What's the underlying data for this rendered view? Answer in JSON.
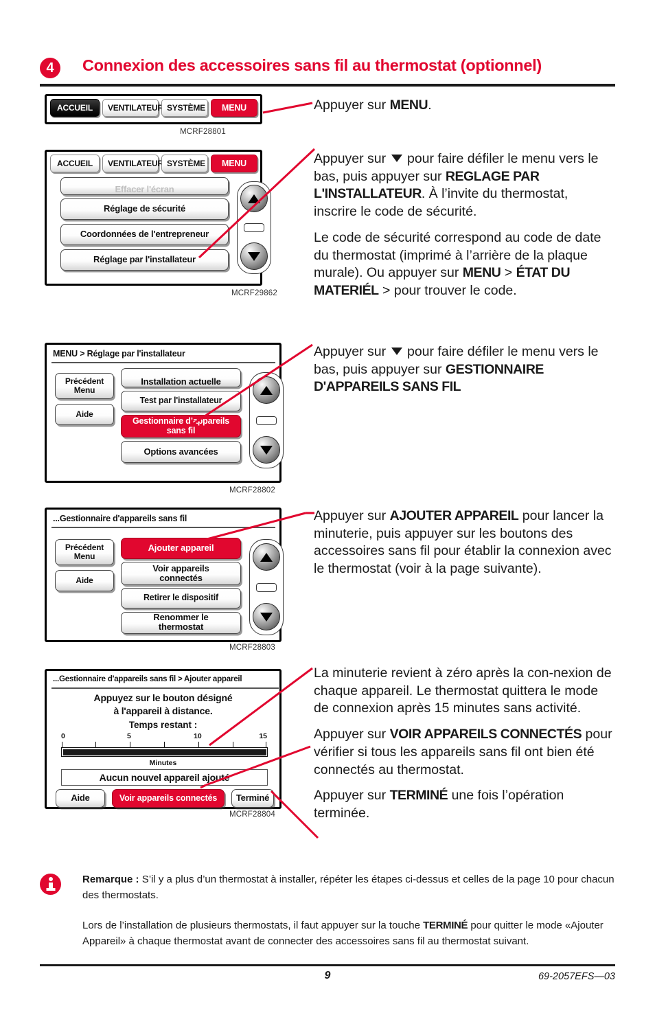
{
  "header": {
    "step_number": "4",
    "title": "Connexion des accessoires sans fil au thermostat (optionnel)"
  },
  "screens": [
    {
      "id": "screen-1",
      "caption": "MCRF28801",
      "tabs": [
        {
          "label": "ACCUEIL",
          "style": "dark"
        },
        {
          "label": "VENTILATEUR",
          "style": "light"
        },
        {
          "label": "SYSTÈME",
          "style": "light"
        },
        {
          "label": "MENU",
          "style": "red"
        }
      ]
    },
    {
      "id": "screen-2",
      "caption": "MCRF29862",
      "tabs": [
        {
          "label": "ACCUEIL",
          "style": "light"
        },
        {
          "label": "VENTILATEUR",
          "style": "light"
        },
        {
          "label": "SYSTÈME",
          "style": "light"
        },
        {
          "label": "MENU",
          "style": "red"
        }
      ],
      "items": [
        {
          "label": "Effacer l'écran",
          "style": "light",
          "clipped": true
        },
        {
          "label": "Réglage de sécurité",
          "style": "light"
        },
        {
          "label": "Coordonnées de l'entrepreneur",
          "style": "light"
        },
        {
          "label": "Réglage par l'installateur",
          "style": "light"
        }
      ]
    },
    {
      "id": "screen-3",
      "caption": "MCRF28802",
      "breadcrumb": "MENU > Réglage par l'installateur",
      "side_buttons": [
        {
          "label": "Précédent\nMenu"
        },
        {
          "label": "Aide"
        }
      ],
      "items": [
        {
          "label": "Installation actuelle",
          "style": "light",
          "clipped": true
        },
        {
          "label": "Test par l'installateur",
          "style": "light"
        },
        {
          "label": "Gestionnaire d'appareils sans fil",
          "style": "red"
        },
        {
          "label": "Options avancées",
          "style": "light"
        }
      ]
    },
    {
      "id": "screen-4",
      "caption": "MCRF28803",
      "breadcrumb": "...Gestionnaire d'appareils sans fil",
      "side_buttons": [
        {
          "label": "Précédent\nMenu"
        },
        {
          "label": "Aide"
        }
      ],
      "items": [
        {
          "label": "Ajouter appareil",
          "style": "red"
        },
        {
          "label": "Voir appareils connectés",
          "style": "light"
        },
        {
          "label": "Retirer le dispositif",
          "style": "light"
        },
        {
          "label": "Renommer le thermostat",
          "style": "light",
          "clipped": true
        }
      ]
    },
    {
      "id": "screen-5",
      "caption": "MCRF28804",
      "breadcrumb": "...Gestionnaire d'appareils sans fil > Ajouter appareil",
      "prompt": "Appuyez sur le bouton désigné\nà l'appareil à distance.",
      "timer_label": "Temps restant :",
      "status": "Aucun nouvel appareil ajouté",
      "buttons": [
        {
          "label": "Aide",
          "style": "light"
        },
        {
          "label": "Voir appareils connectés",
          "style": "red"
        },
        {
          "label": "Terminé",
          "style": "light"
        }
      ],
      "timer": {
        "axis_label": "Minutes",
        "tick_labels": [
          "0",
          "5",
          "10",
          "15"
        ],
        "minor_ticks": [
          0,
          2.5,
          5,
          7.5,
          10,
          12.5,
          15
        ],
        "min": 0,
        "max": 15,
        "remaining": 15,
        "fill_percent": 100
      }
    }
  ],
  "instructions": [
    {
      "id": "instr-1",
      "parts": [
        {
          "t": "Appuyer sur "
        },
        {
          "t": "MENU",
          "b": true
        },
        {
          "t": "."
        }
      ]
    },
    {
      "id": "instr-2",
      "paragraphs": [
        [
          {
            "t": "Appuyer sur "
          },
          {
            "icon": "triangle-down"
          },
          {
            "t": " pour faire défiler le menu vers le bas, puis appuyer sur "
          },
          {
            "t": "REGLAGE PAR L'INSTALLATEUR",
            "b": true
          },
          {
            "t": ". À l’invite du thermostat, inscrire le code de sécurité."
          }
        ],
        [
          {
            "t": "Le code de sécurité correspond au code de date du thermostat (imprimé à l’arrière de la plaque murale). Ou appuyer sur "
          },
          {
            "t": "MENU",
            "b": true
          },
          {
            "t": " > "
          },
          {
            "t": "ÉTAT DU MATERIÉL",
            "b": true
          },
          {
            "t": " > pour trouver le code."
          }
        ]
      ]
    },
    {
      "id": "instr-3",
      "paragraphs": [
        [
          {
            "t": "Appuyer sur "
          },
          {
            "icon": "triangle-down"
          },
          {
            "t": " pour faire défiler le menu vers le bas, puis appuyer sur "
          },
          {
            "t": "GESTIONNAIRE D'APPAREILS SANS FIL",
            "b": true
          }
        ]
      ]
    },
    {
      "id": "instr-4",
      "paragraphs": [
        [
          {
            "t": "Appuyer sur "
          },
          {
            "t": "AJOUTER APPAREIL",
            "b": true
          },
          {
            "t": " pour lancer la minuterie, puis appuyer sur les boutons des accessoires sans fil pour établir la connexion avec le thermostat (voir à la page suivante)."
          }
        ]
      ]
    },
    {
      "id": "instr-5",
      "paragraphs": [
        [
          {
            "t": "La minuterie revient à zéro après la con-nexion de chaque appareil. Le thermostat quittera le mode de connexion après 15 minutes sans activité."
          }
        ],
        [
          {
            "t": "Appuyer sur "
          },
          {
            "t": "VOIR APPAREILS CONNECTÉS",
            "b": true
          },
          {
            "t": " pour vérifier si tous les appareils sans fil ont bien été connectés au thermostat."
          }
        ],
        [
          {
            "t": "Appuyer sur "
          },
          {
            "t": "TERMINÉ",
            "b": true
          },
          {
            "t": " une fois l’opération terminée."
          }
        ]
      ]
    }
  ],
  "note": {
    "icon": "info-icon",
    "label": "Remarque :",
    "paragraph_1_rest": " S’il y a plus d’un thermostat à installer, répéter les étapes ci-dessus et celles de la page 10 pour chacun des thermostats.",
    "paragraph_2": [
      {
        "t": "Lors de l’installation de plusieurs thermostats, il faut appuyer sur la touche "
      },
      {
        "t": "TERMINÉ",
        "b": true
      },
      {
        "t": " pour quitter le mode «Ajouter Appareil» à chaque thermostat avant de connecter des accessoires sans fil au thermostat suivant."
      }
    ]
  },
  "footer": {
    "page_number": "9",
    "part_number": "69-2057EFS—03"
  },
  "colors": {
    "accent_red": "#e1072f",
    "text": "#1a1a1a"
  }
}
